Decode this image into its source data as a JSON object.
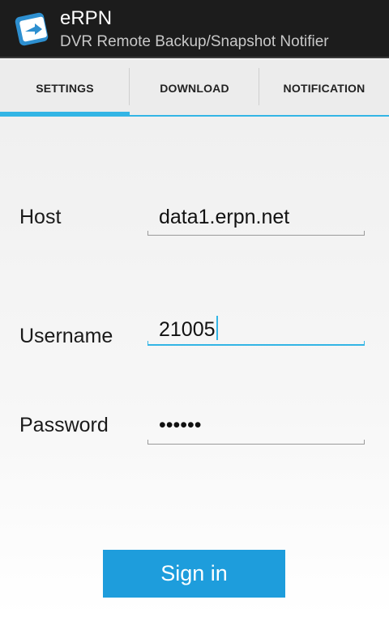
{
  "app": {
    "title": "eRPN",
    "subtitle": "DVR Remote Backup/Snapshot Notifier",
    "icon": "erpn-app-icon"
  },
  "tabs": [
    {
      "label": "SETTINGS",
      "selected": true
    },
    {
      "label": "DOWNLOAD",
      "selected": false
    },
    {
      "label": "NOTIFICATION",
      "selected": false
    }
  ],
  "form": {
    "host": {
      "label": "Host",
      "value": "data1.erpn.net"
    },
    "username": {
      "label": "Username",
      "value": "21005",
      "focused": true
    },
    "password": {
      "label": "Password",
      "value": "••••••"
    }
  },
  "signin_label": "Sign in",
  "colors": {
    "actionbar": "#1c1c1c",
    "accent": "#33b5e5",
    "button": "#1e9ddc"
  }
}
